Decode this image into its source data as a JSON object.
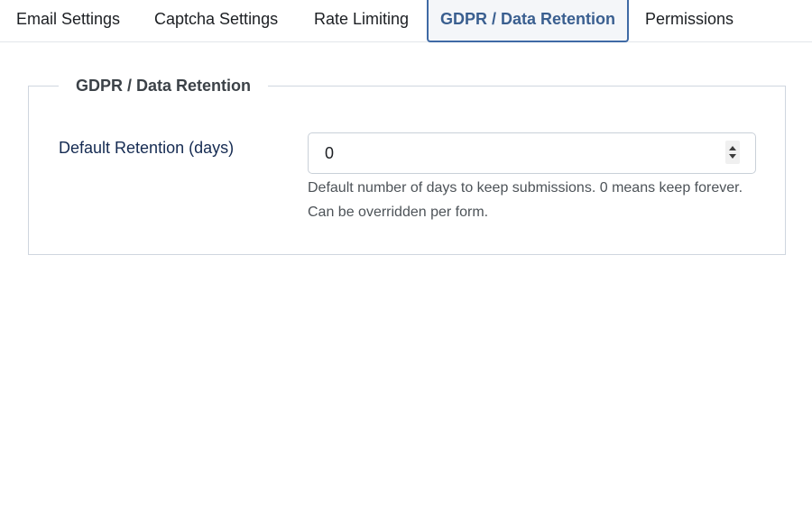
{
  "tabs": [
    {
      "label": "Email Settings"
    },
    {
      "label": "Captcha Settings"
    },
    {
      "label": "Rate Limiting"
    },
    {
      "label": "GDPR / Data Retention",
      "active": true
    },
    {
      "label": "Permissions"
    }
  ],
  "section": {
    "legend": "GDPR / Data Retention",
    "field": {
      "label": "Default Retention (days)",
      "value": "0",
      "help_line1": "Default number of days to keep submissions. 0 means keep forever.",
      "help_line2": "Can be overridden per form."
    }
  },
  "colors": {
    "active_tab_text": "#3a5f90",
    "active_tab_border": "#3f6aa5",
    "label_text": "#152b52"
  }
}
